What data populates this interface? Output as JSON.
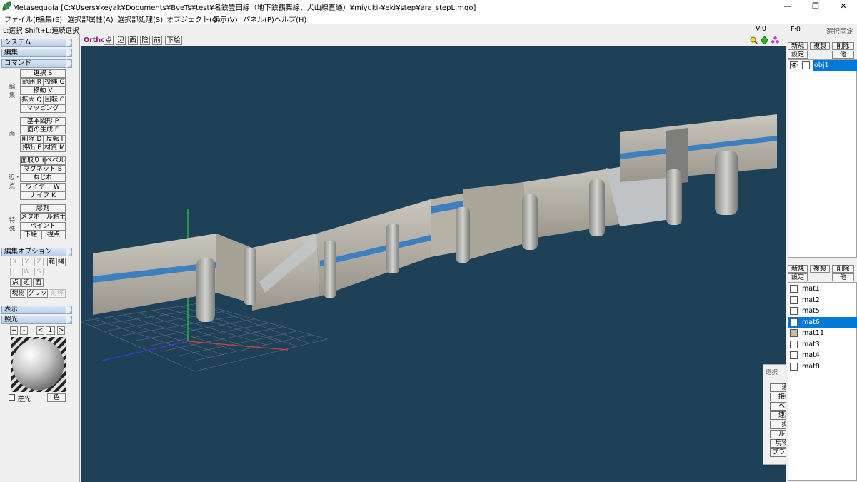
{
  "window": {
    "title": "Metasequoia [C:¥Users¥keyak¥Documents¥BveTs¥test¥名鉄豊田線（地下鉄鶴舞線、犬山線直通）¥miyuki-¥eki¥step¥ara_stepL.mqo]",
    "minimize": "—",
    "maximize": "❐",
    "close": "✕"
  },
  "menu": [
    "ファイル(F)",
    "編集(E)",
    "選択部属性(A)",
    "選択部処理(S)",
    "オブジェクト(O)",
    "表示(V)",
    "パネル(P)",
    "ヘルプ(H)"
  ],
  "status": {
    "hint": "L:選択  Shift+L:連続選択",
    "v_readout": "V:0",
    "f_readout": "F:0",
    "sel_fixed": "選択固定"
  },
  "left": {
    "sec_system": "システム",
    "sec_edit": "編集",
    "sec_command": "コマンド",
    "grp_edit_label": "編集",
    "grp_face_label": "面",
    "grp_edge_label": "辺・点",
    "grp_special_label": "特殊",
    "cmd": {
      "select": "選択 S",
      "range": "範囲 R",
      "lasso": "投縄 G",
      "move": "移動 V",
      "scale": "拡大 Q",
      "rotate": "回転 C",
      "mapping": "マッピング",
      "primitive": "基本図形 P",
      "face_gen": "面の生成 F",
      "delete": "削除 D",
      "flip": "反転 I",
      "extrude": "押出 E",
      "material": "材質 M",
      "chamfer": "面取り H",
      "bevel": "ベベル",
      "magnet": "マグネット B",
      "twist": "ねじれ",
      "wire": "ワイヤー W",
      "knife": "ナイフ K",
      "sculpt": "彫刻",
      "metaball": "メタボール粘土",
      "paint": "ペイント",
      "underlay": "下絵",
      "viewpoint": "視点"
    },
    "sec_editopt": "編集オプション",
    "opt": {
      "x": "X",
      "y": "Y",
      "z": "Z",
      "range": "範",
      "lasso": "縄",
      "l": "L",
      "w": "W",
      "s": "S",
      "point": "点",
      "edge": "辺",
      "face": "面",
      "current": "現物",
      "grid": "グリッド",
      "sym": "対称"
    },
    "sec_view": "表示",
    "sec_light": "照光",
    "light": {
      "plus": "+",
      "minus": "-",
      "prev": "<",
      "num": "1",
      "next": ">",
      "backlight": "逆光",
      "color": "色"
    }
  },
  "viewport": {
    "mode": "Ortho",
    "buttons": [
      "点",
      "辺",
      "面",
      "陰",
      "前",
      "下絵"
    ],
    "toolicons": [
      "zoom-icon",
      "move-view-icon",
      "rotate-view-icon"
    ]
  },
  "select_window": {
    "title": "選択",
    "items": [
      "通常",
      "接続面",
      "ベルト",
      "連続辺",
      "拡張",
      "ルート",
      "現物指定",
      "ブラシ選択"
    ]
  },
  "right": {
    "obj_buttons": {
      "new": "新規",
      "dup": "複製",
      "del": "削除",
      "settings": "設定",
      "other": "他"
    },
    "objects": [
      {
        "name": "obj1",
        "selected": true
      }
    ],
    "mat_buttons": {
      "new": "新規",
      "dup": "複製",
      "del": "削除",
      "settings": "設定",
      "other": "他"
    },
    "materials": [
      {
        "name": "mat1",
        "color": "#ffffff",
        "selected": false
      },
      {
        "name": "mat2",
        "color": "#ffffff",
        "selected": false
      },
      {
        "name": "mat5",
        "color": "#ffffff",
        "selected": false
      },
      {
        "name": "mat6",
        "color": "#ffffff",
        "selected": true
      },
      {
        "name": "mat11",
        "color": "#c8bba0",
        "selected": false
      },
      {
        "name": "mat3",
        "color": "#ffffff",
        "selected": false
      },
      {
        "name": "mat4",
        "color": "#ffffff",
        "selected": false
      },
      {
        "name": "mat8",
        "color": "#ffffff",
        "selected": false
      }
    ]
  },
  "colors": {
    "viewport_bg": "#1e4158",
    "selection": "#0078d7",
    "ortho_text": "#8b1a6b"
  }
}
